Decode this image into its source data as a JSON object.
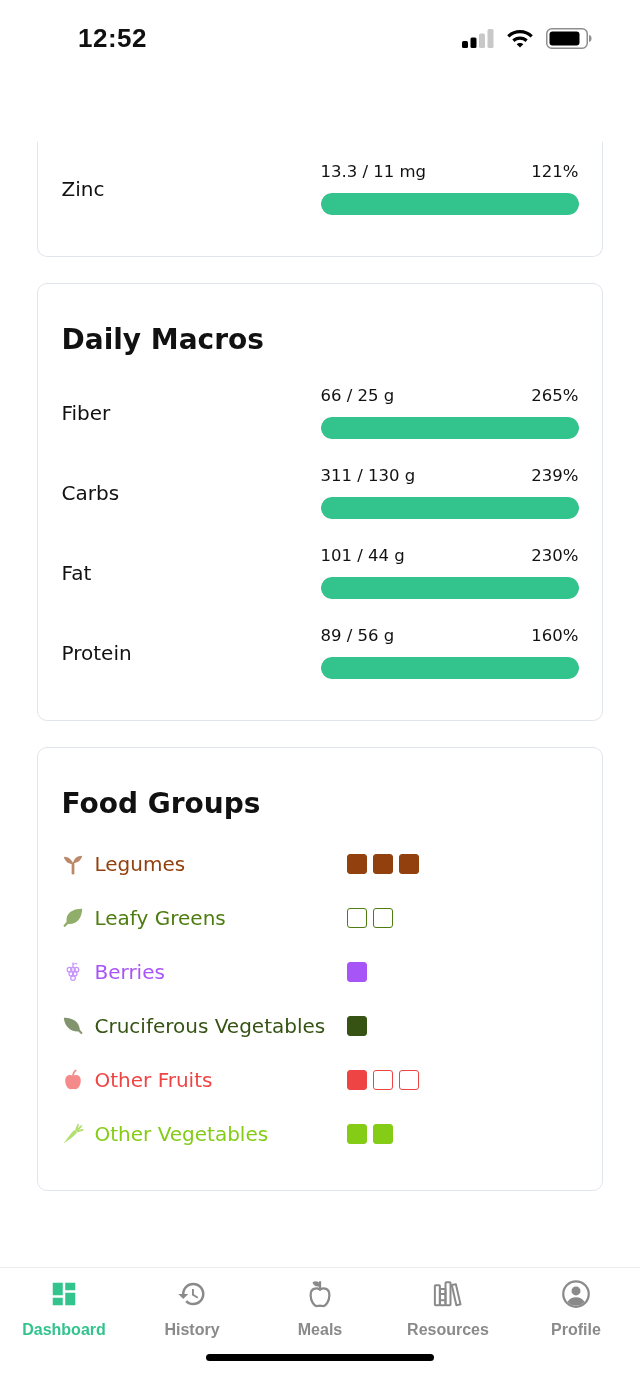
{
  "status_bar": {
    "time": "12:52"
  },
  "nutrient_card": {
    "rows": [
      {
        "name": "Zinc",
        "amount": "13.3 / 11 mg",
        "percent": "121%",
        "level": 1
      }
    ]
  },
  "macros_card": {
    "title": "Daily Macros",
    "rows": [
      {
        "name": "Fiber",
        "amount": "66 / 25 g",
        "percent": "265%",
        "level": 1
      },
      {
        "name": "Carbs",
        "amount": "311 / 130 g",
        "percent": "239%",
        "level": 1
      },
      {
        "name": "Fat",
        "amount": "101 / 44 g",
        "percent": "230%",
        "level": 1
      },
      {
        "name": "Protein",
        "amount": "89 / 56 g",
        "percent": "160%",
        "level": 1
      }
    ]
  },
  "food_groups_card": {
    "title": "Food Groups",
    "items": [
      {
        "name": "Legumes",
        "color": "#92400e",
        "servings": [
          {
            "filled": true
          },
          {
            "filled": true
          },
          {
            "filled": true
          }
        ]
      },
      {
        "name": "Leafy Greens",
        "color": "#4d7c0f",
        "servings": [
          {
            "filled": false
          },
          {
            "filled": false
          }
        ]
      },
      {
        "name": "Berries",
        "color": "#a855f7",
        "servings": [
          {
            "filled": true
          }
        ]
      },
      {
        "name": "Cruciferous Vegetables",
        "color": "#365314",
        "servings": [
          {
            "filled": true
          }
        ]
      },
      {
        "name": "Other Fruits",
        "color": "#ef4444",
        "servings": [
          {
            "filled": true
          },
          {
            "filled": false
          },
          {
            "filled": false
          }
        ]
      },
      {
        "name": "Other Vegetables",
        "color": "#84cc16",
        "servings": [
          {
            "filled": true
          },
          {
            "filled": true
          }
        ]
      }
    ]
  },
  "tab_bar": {
    "tabs": [
      {
        "label": "Dashboard",
        "selected": true
      },
      {
        "label": "History",
        "selected": false
      },
      {
        "label": "Meals",
        "selected": false
      },
      {
        "label": "Resources",
        "selected": false
      },
      {
        "label": "Profile",
        "selected": false
      }
    ]
  }
}
